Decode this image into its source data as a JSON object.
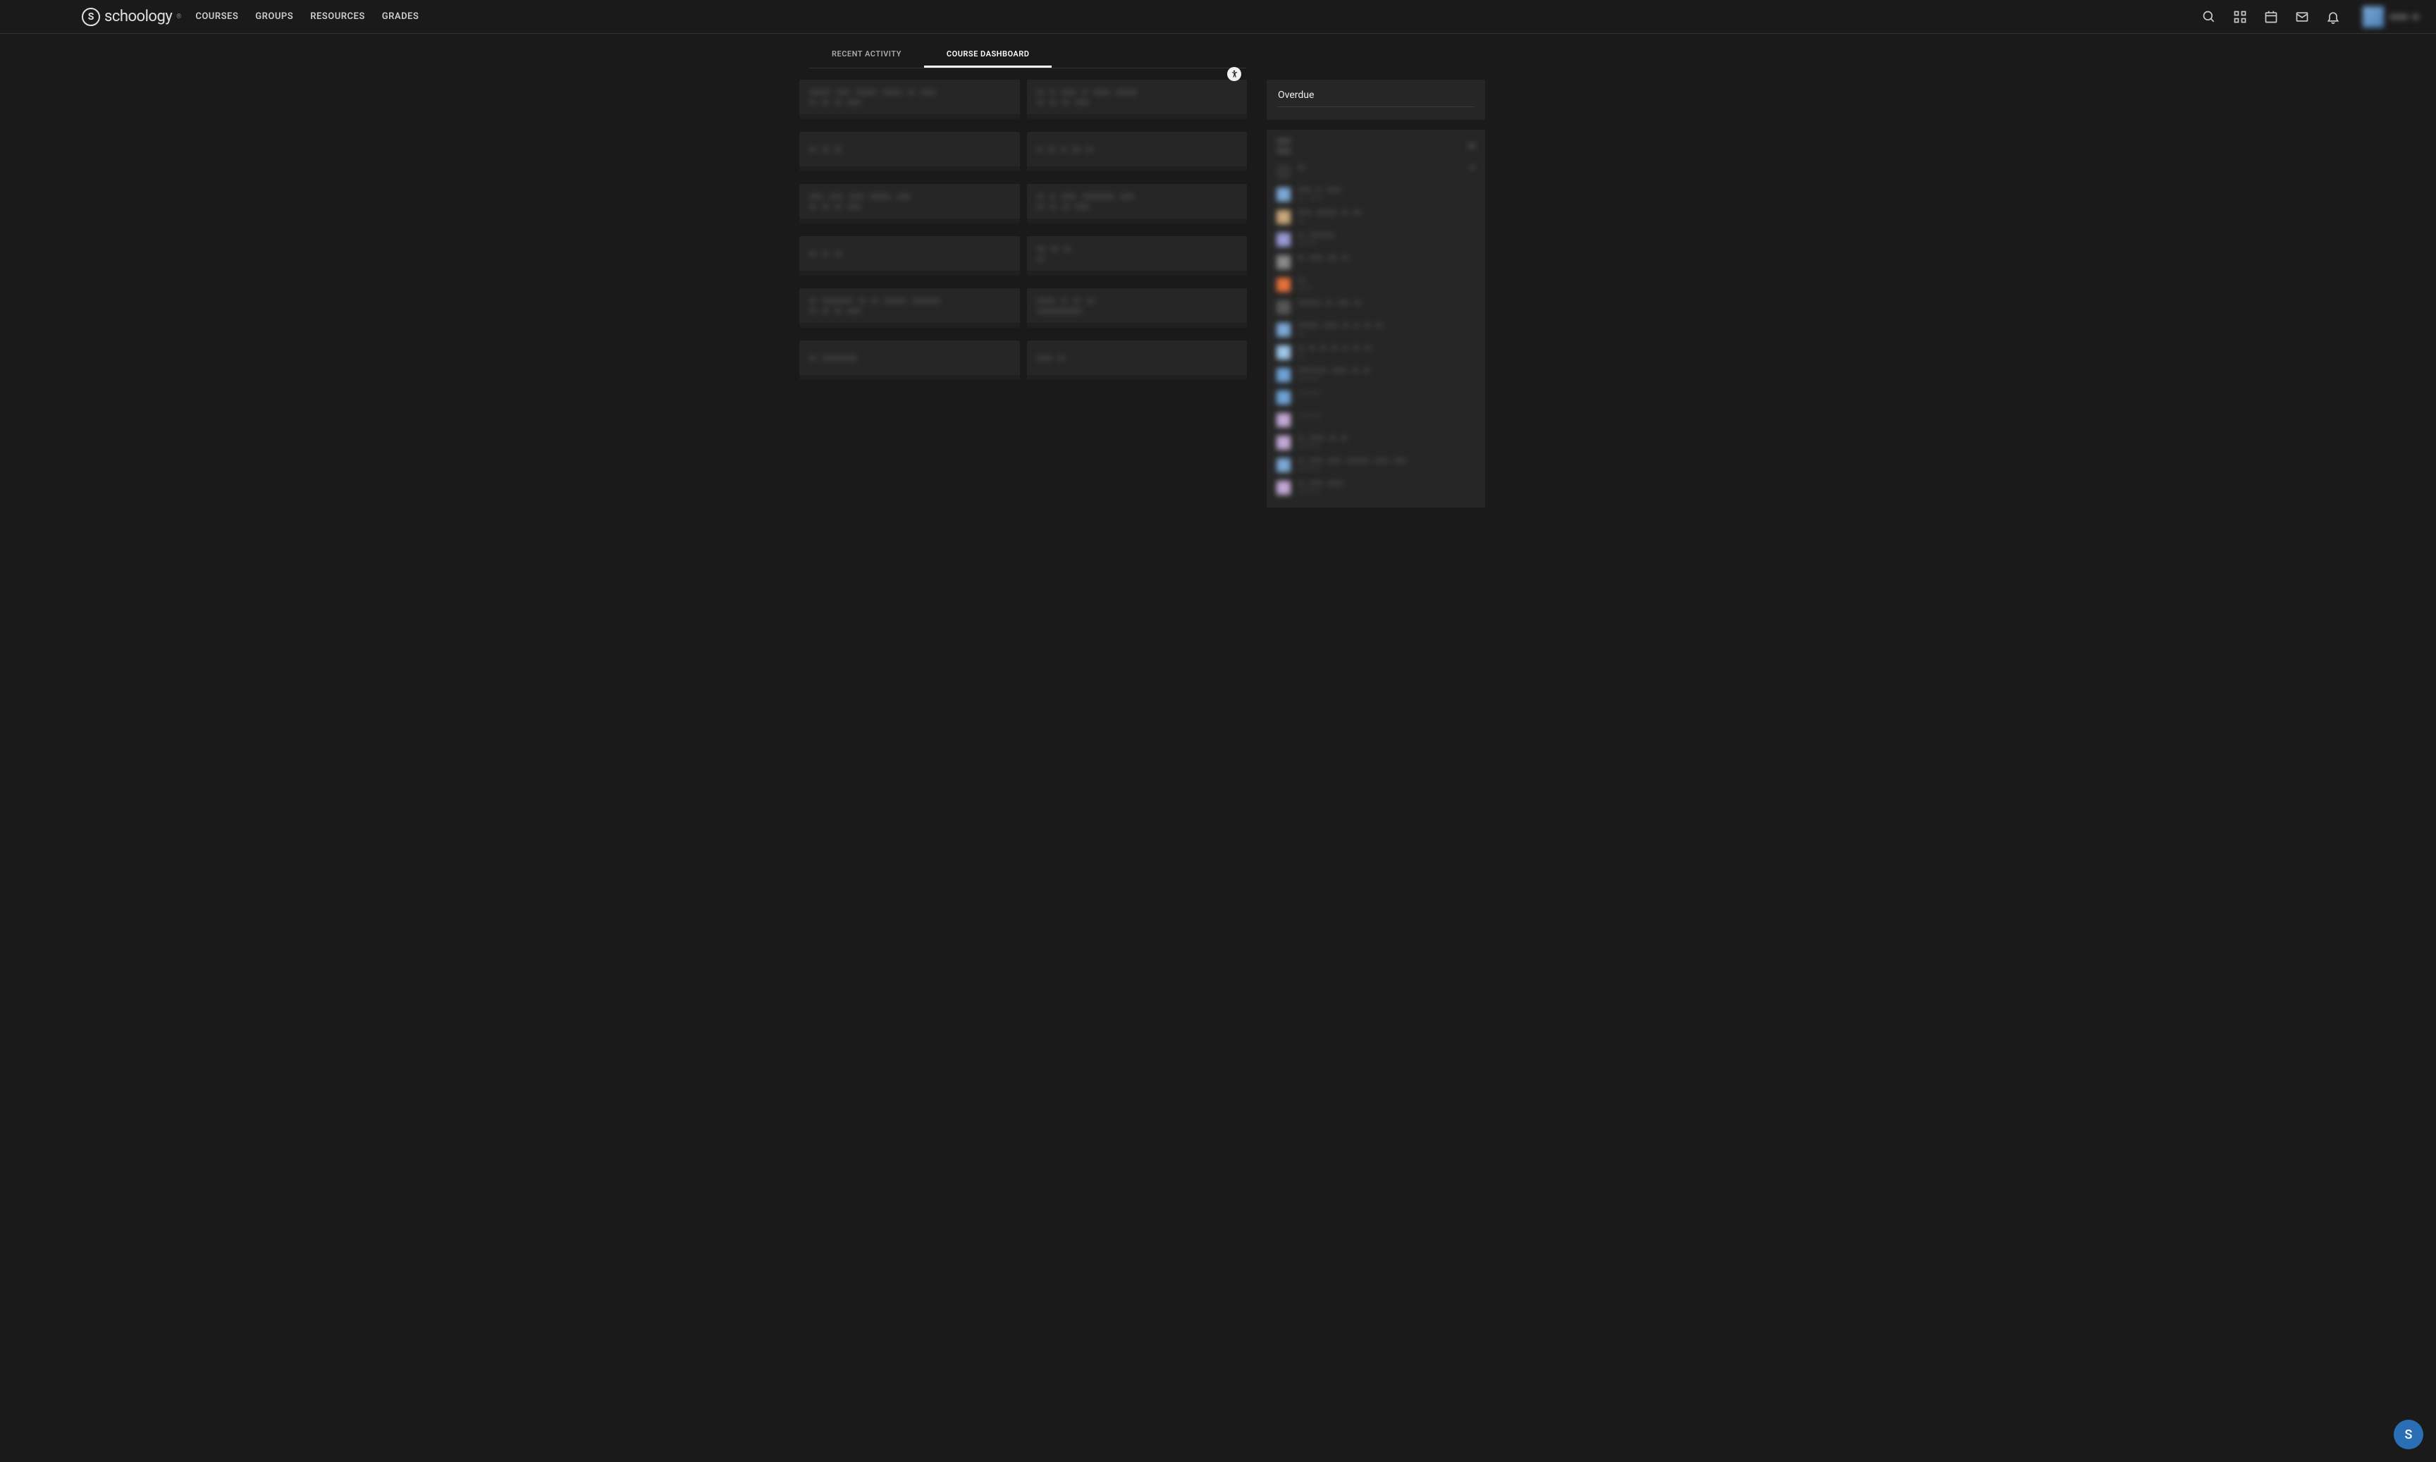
{
  "brand": {
    "logo_text": "schoology",
    "logo_mark": "S"
  },
  "topnav": [
    "COURSES",
    "GROUPS",
    "RESOURCES",
    "GRADES"
  ],
  "user": {
    "name_parts": [
      "Firstname",
      "L."
    ]
  },
  "tabs": [
    {
      "label": "RECENT ACTIVITY",
      "active": false
    },
    {
      "label": "COURSE DASHBOARD",
      "active": true
    }
  ],
  "courses": [
    {
      "title_widths": [
        30,
        20,
        30,
        28,
        10,
        22
      ],
      "sub_widths": [
        10,
        10,
        10,
        20
      ]
    },
    {
      "title_widths": [
        10,
        8,
        22,
        8,
        24,
        30
      ],
      "sub_widths": [
        10,
        10,
        10,
        20
      ]
    },
    {
      "title_widths": [
        10,
        10,
        10
      ],
      "sub_widths": []
    },
    {
      "title_widths": [
        8,
        10,
        8,
        12,
        10
      ],
      "sub_widths": []
    },
    {
      "title_widths": [
        20,
        20,
        22,
        30,
        20
      ],
      "sub_widths": [
        10,
        10,
        10,
        20
      ]
    },
    {
      "title_widths": [
        10,
        8,
        22,
        46,
        20
      ],
      "sub_widths": [
        10,
        10,
        10,
        20
      ]
    },
    {
      "title_widths": [
        10,
        10,
        10
      ],
      "sub_widths": []
    },
    {
      "title_widths": [
        12,
        10,
        10
      ],
      "sub_widths": [
        10
      ]
    },
    {
      "title_widths": [
        10,
        44,
        10,
        10,
        32,
        40
      ],
      "sub_widths": [
        10,
        10,
        10,
        20
      ]
    },
    {
      "title_widths": [
        26,
        10,
        10,
        12
      ],
      "sub_widths": [
        64
      ]
    },
    {
      "title_widths": [
        10,
        50
      ],
      "sub_widths": []
    },
    {
      "title_widths": [
        22,
        10
      ],
      "sub_widths": []
    }
  ],
  "overdue": {
    "title": "Overdue"
  },
  "sidebar_items": [
    {
      "thumb": "#333333",
      "line_widths": [
        10
      ],
      "sub_widths": [],
      "trail_widths": [
        8
      ]
    },
    {
      "thumb": "#7aa8d6",
      "line_widths": [
        20,
        8,
        22
      ],
      "sub_widths": [
        10,
        20
      ]
    },
    {
      "thumb": "#c9a87a",
      "line_widths": [
        20,
        30,
        10,
        12
      ],
      "sub_widths": [
        10
      ]
    },
    {
      "thumb": "#9a9ad6",
      "line_widths": [
        10,
        36
      ],
      "sub_widths": [
        28
      ]
    },
    {
      "thumb": "#888888",
      "line_widths": [
        10,
        20,
        14,
        10
      ],
      "sub_widths": []
    },
    {
      "thumb": "#e6713a",
      "line_widths": [
        10
      ],
      "sub_widths": [
        20
      ]
    },
    {
      "thumb": "#555555",
      "line_widths": [
        34,
        10,
        18,
        10
      ],
      "sub_widths": []
    },
    {
      "thumb": "#7aa8d6",
      "line_widths": [
        30,
        22,
        10,
        8,
        10,
        10
      ],
      "sub_widths": [
        10
      ]
    },
    {
      "thumb": "#9ec5e8",
      "line_widths": [
        10,
        10,
        10,
        10,
        8,
        10,
        10
      ],
      "sub_widths": [
        10
      ]
    },
    {
      "thumb": "#6fa3d6",
      "line_widths": [
        42,
        22,
        10,
        10
      ],
      "sub_widths": [
        30
      ]
    },
    {
      "thumb": "#6fa3d6",
      "line_widths": [],
      "sub_widths": [
        32
      ]
    },
    {
      "thumb": "#c3a8d6",
      "line_widths": [],
      "sub_widths": [
        34
      ]
    },
    {
      "thumb": "#c3a8d6",
      "line_widths": [
        10,
        22,
        10,
        10
      ],
      "sub_widths": [
        32
      ]
    },
    {
      "thumb": "#7aa8d6",
      "line_widths": [
        10,
        20,
        20,
        34,
        22,
        18
      ],
      "sub_widths": [
        32
      ]
    },
    {
      "thumb": "#c3a8d6",
      "line_widths": [
        10,
        20,
        22
      ],
      "sub_widths": [
        32
      ]
    }
  ],
  "fab": {
    "initial": "S"
  }
}
